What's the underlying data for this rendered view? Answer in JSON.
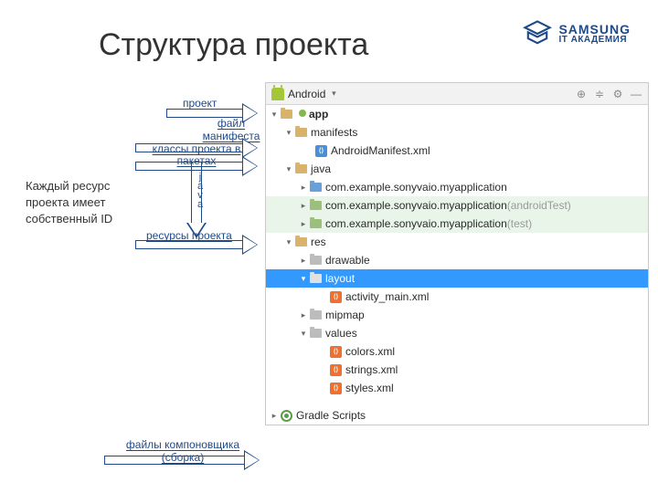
{
  "title": "Структура проекта",
  "logo": {
    "main": "SAMSUNG",
    "sub": "IT АКАДЕМИЯ"
  },
  "side_text": "Каждый ресурс проекта имеет собственный ID",
  "labels": {
    "project": "проект",
    "manifest": "файл манифеста",
    "classes_l1": "классы проекта в",
    "classes_l2": "пакетах",
    "java_vertical": "java",
    "resources": "ресурсы проекта",
    "gradle_l1": "файлы  компоновщика",
    "gradle_l2": "(сборка)"
  },
  "toolbar": {
    "mode": "Android"
  },
  "tree": {
    "app": "app",
    "manifests": "manifests",
    "manifest_file": "AndroidManifest.xml",
    "java": "java",
    "pkg1": "com.example.sonyvaio.myapplication",
    "pkg2": "com.example.sonyvaio.myapplication",
    "pkg2_suffix": " (androidTest)",
    "pkg3": "com.example.sonyvaio.myapplication",
    "pkg3_suffix": " (test)",
    "res": "res",
    "drawable": "drawable",
    "layout": "layout",
    "activity_main": "activity_main.xml",
    "mipmap": "mipmap",
    "values": "values",
    "colors": "colors.xml",
    "strings": "strings.xml",
    "styles": "styles.xml",
    "gradle": "Gradle Scripts"
  }
}
